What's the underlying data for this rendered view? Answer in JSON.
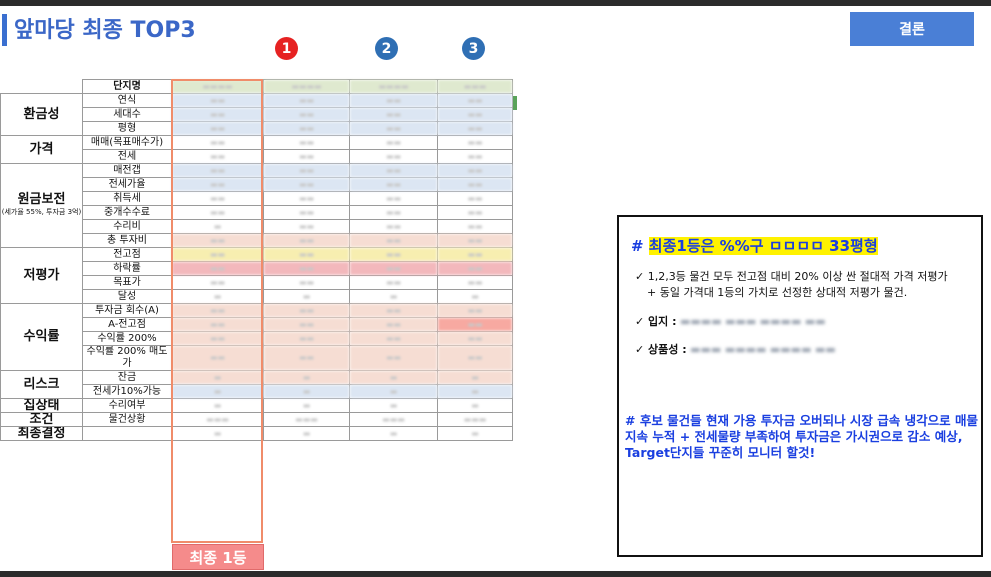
{
  "page": {
    "title": "앞마당 최종 TOP3",
    "conclusion_label": "결론",
    "badges": [
      "1",
      "2",
      "3"
    ],
    "rank_button": "최종 1등"
  },
  "table": {
    "header_label": "단지명",
    "groups": [
      {
        "name": "환금성",
        "rows": [
          "연식",
          "세대수",
          "평형"
        ]
      },
      {
        "name": "가격",
        "rows": [
          "매매(목표매수가)",
          "전세"
        ]
      },
      {
        "name": "원금보전",
        "sub": "(세가율 55%, 투자금 3억)",
        "rows": [
          "매전갭",
          "전세가율",
          "취득세",
          "중개수수료",
          "수리비",
          "총 투자비"
        ]
      },
      {
        "name": "저평가",
        "rows": [
          "전고점",
          "하락률",
          "목표가",
          "달성"
        ]
      },
      {
        "name": "수익률",
        "rows": [
          "투자금 회수(A)",
          "A-전고점",
          "수익률 200%",
          "수익률 200% 매도가"
        ]
      },
      {
        "name": "리스크",
        "rows": [
          "잔금",
          "전세가10%가능"
        ]
      },
      {
        "name": "집상태",
        "rows": [
          "수리여부"
        ]
      },
      {
        "name": "조건",
        "rows": [
          "물건상황"
        ]
      },
      {
        "name": "최종결정",
        "rows": [
          ""
        ]
      }
    ]
  },
  "conclusion_box": {
    "heading_prefix": "# ",
    "heading_highlight": "최종1등은 %%구 ㅁㅁㅁㅁ 33평형",
    "bullet1": "✓ 1,2,3등 물건 모두 전고점 대비 20% 이상 싼 절대적 가격 저평가",
    "bullet1_cont": "+ 동일 가격대 1등의 가치로 선정한 상대적 저평가 물건.",
    "bullet2_label": "✓ 입지 :",
    "bullet3_label": "✓ 상품성 :",
    "note": "# 후보 물건들 현재 가용 투자금 오버되나 시장 급속 냉각으로 매물 지속 누적 + 전세물량 부족하여 투자금은 가시권으로 감소 예상, Target단지들 꾸준히 모니터 할것!"
  }
}
